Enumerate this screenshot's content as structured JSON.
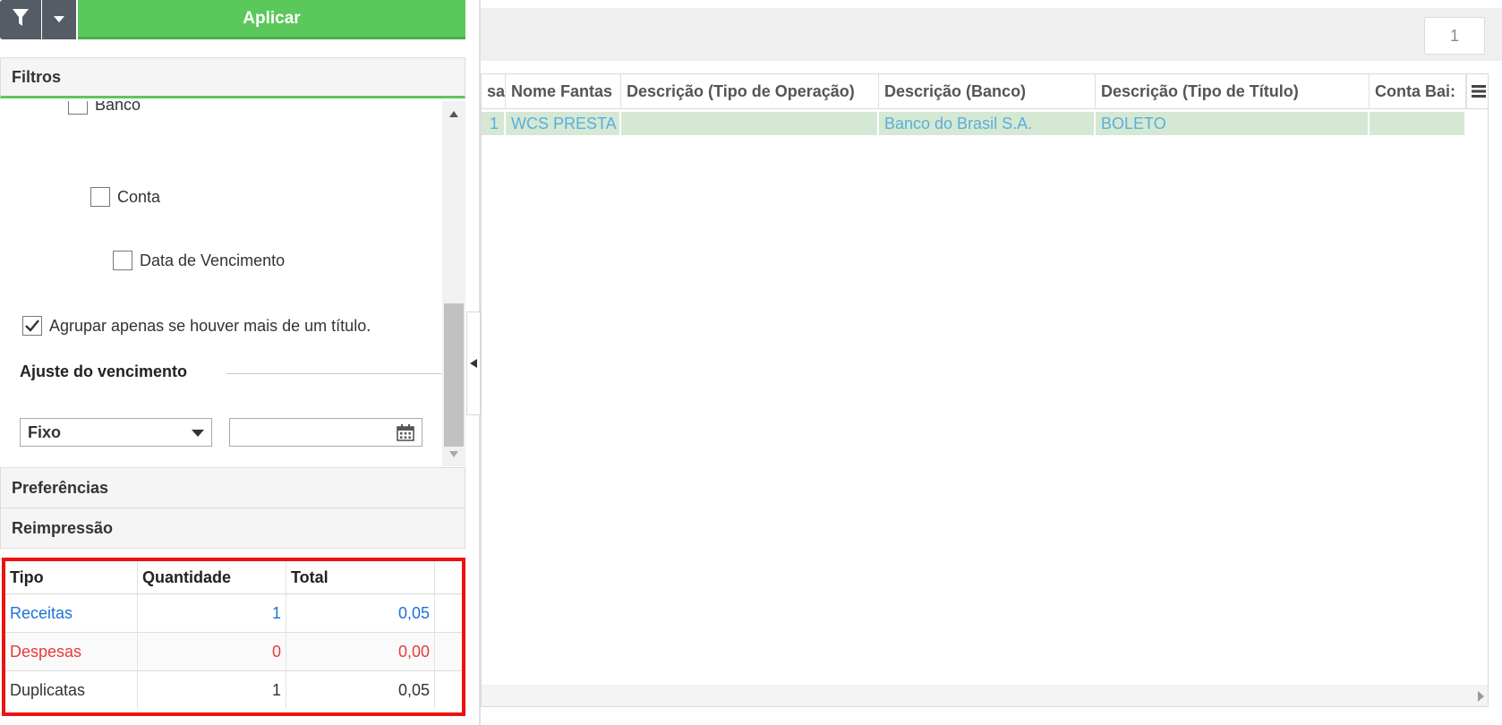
{
  "toolbar": {
    "apply_label": "Aplicar"
  },
  "sections": {
    "filtros": "Filtros",
    "preferencias": "Preferências",
    "reimpressao": "Reimpressão"
  },
  "filters": {
    "checkboxes": [
      {
        "label": "Banco",
        "checked": false
      },
      {
        "label": "Conta",
        "checked": false
      },
      {
        "label": "Data de Vencimento",
        "checked": false
      }
    ],
    "group_option": {
      "label": "Agrupar apenas se houver mais de um título.",
      "checked": true
    },
    "due_adjust": {
      "title": "Ajuste do vencimento",
      "mode_value": "Fixo",
      "date_value": ""
    }
  },
  "summary": {
    "headers": [
      "Tipo",
      "Quantidade",
      "Total"
    ],
    "rows": [
      {
        "tipo": "Receitas",
        "quantidade": "1",
        "total": "0,05"
      },
      {
        "tipo": "Despesas",
        "quantidade": "0",
        "total": "0,00"
      },
      {
        "tipo": "Duplicatas",
        "quantidade": "1",
        "total": "0,05"
      }
    ]
  },
  "pager": {
    "current_page": "1"
  },
  "grid": {
    "columns": [
      "sa",
      "Nome Fantas",
      "Descrição (Tipo de Operação)",
      "Descrição (Banco)",
      "Descrição (Tipo de Título)",
      "Conta Bai:"
    ],
    "rows": [
      [
        "1",
        "WCS PRESTA",
        "",
        "Banco do Brasil S.A.",
        "BOLETO",
        ""
      ]
    ]
  },
  "colors": {
    "apply_green": "#5bc85b",
    "receitas": "#1a73d9",
    "despesas": "#e63b3b",
    "highlight_border": "#ee1111",
    "selected_row": "#d5e8d4",
    "row_text": "#5aaedc"
  }
}
